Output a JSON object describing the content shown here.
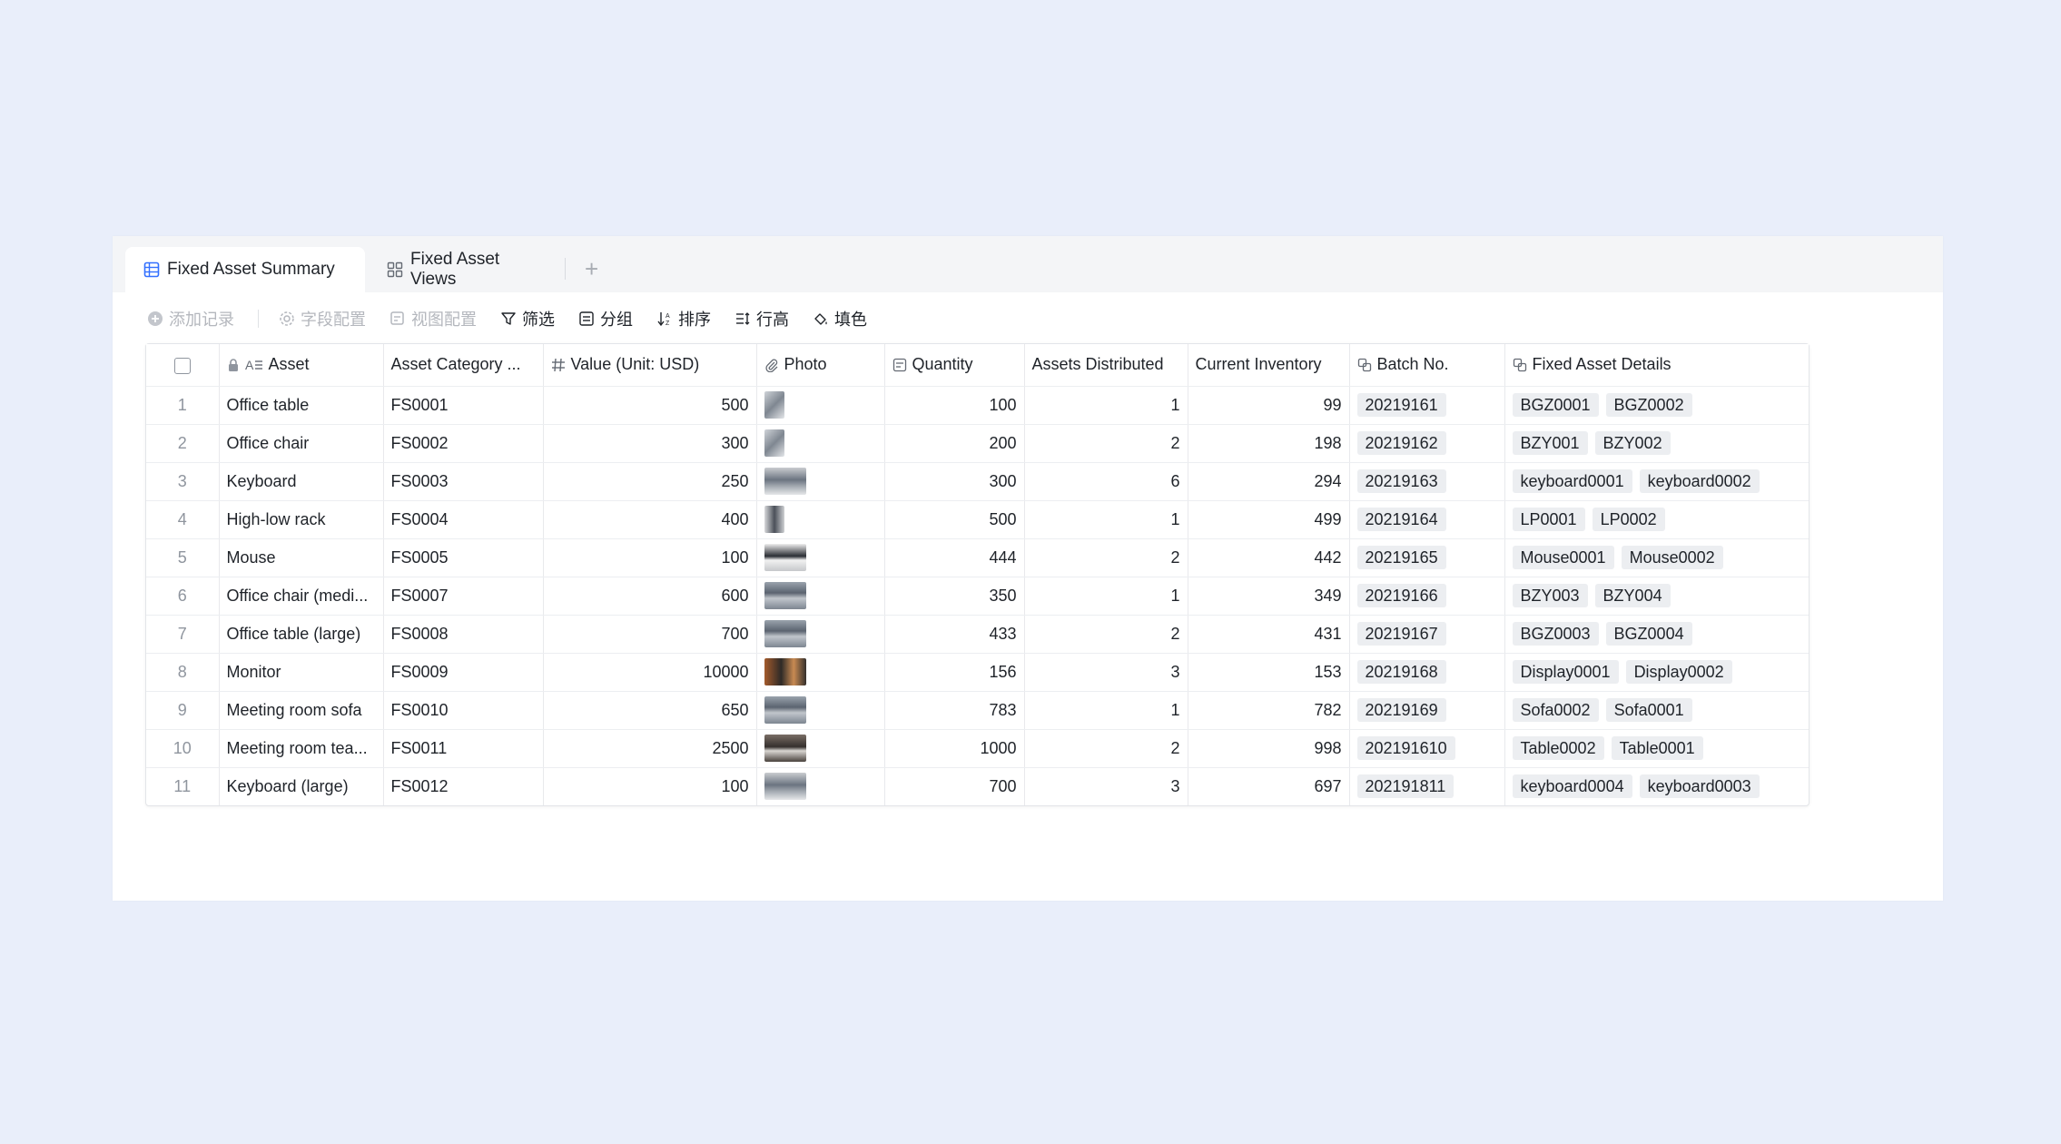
{
  "tabs": [
    {
      "label": "Fixed Asset Summary",
      "icon": "grid-table-icon",
      "active": true
    },
    {
      "label": "Fixed Asset Views",
      "icon": "four-squares-icon",
      "active": false
    }
  ],
  "add_tab_label": "+",
  "toolbar": {
    "add_record": "添加记录",
    "field_config": "字段配置",
    "view_config": "视图配置",
    "filter": "筛选",
    "group": "分组",
    "sort": "排序",
    "row_height": "行高",
    "fill_color": "填色"
  },
  "columns": {
    "asset": "Asset",
    "category": "Asset Category ...",
    "value": "Value (Unit: USD)",
    "photo": "Photo",
    "quantity": "Quantity",
    "distributed": "Assets Distributed",
    "inventory": "Current Inventory",
    "batch": "Batch No.",
    "details": "Fixed Asset Details"
  },
  "rows": [
    {
      "n": "1",
      "asset": "Office table",
      "cat": "FS0001",
      "value": "500",
      "photo": "office-table-photo",
      "qty": "100",
      "dist": "1",
      "inv": "99",
      "batch": "20219161",
      "details": [
        "BGZ0001",
        "BGZ0002"
      ]
    },
    {
      "n": "2",
      "asset": "Office chair",
      "cat": "FS0002",
      "value": "300",
      "photo": "office-chair-photo",
      "qty": "200",
      "dist": "2",
      "inv": "198",
      "batch": "20219162",
      "details": [
        "BZY001",
        "BZY002"
      ]
    },
    {
      "n": "3",
      "asset": "Keyboard",
      "cat": "FS0003",
      "value": "250",
      "photo": "keyboard-photo",
      "qty": "300",
      "dist": "6",
      "inv": "294",
      "batch": "20219163",
      "details": [
        "keyboard0001",
        "keyboard0002"
      ]
    },
    {
      "n": "4",
      "asset": "High-low rack",
      "cat": "FS0004",
      "value": "400",
      "photo": "rack-photo",
      "qty": "500",
      "dist": "1",
      "inv": "499",
      "batch": "20219164",
      "details": [
        "LP0001",
        "LP0002"
      ]
    },
    {
      "n": "5",
      "asset": "Mouse",
      "cat": "FS0005",
      "value": "100",
      "photo": "mouse-photo",
      "qty": "444",
      "dist": "2",
      "inv": "442",
      "batch": "20219165",
      "details": [
        "Mouse0001",
        "Mouse0002"
      ]
    },
    {
      "n": "6",
      "asset": "Office chair (medi...",
      "cat": "FS0007",
      "value": "600",
      "photo": "office-room-photo",
      "qty": "350",
      "dist": "1",
      "inv": "349",
      "batch": "20219166",
      "details": [
        "BZY003",
        "BZY004"
      ]
    },
    {
      "n": "7",
      "asset": "Office table (large)",
      "cat": "FS0008",
      "value": "700",
      "photo": "office-room-photo",
      "qty": "433",
      "dist": "2",
      "inv": "431",
      "batch": "20219167",
      "details": [
        "BGZ0003",
        "BGZ0004"
      ]
    },
    {
      "n": "8",
      "asset": "Monitor",
      "cat": "FS0009",
      "value": "10000",
      "photo": "monitor-photo",
      "qty": "156",
      "dist": "3",
      "inv": "153",
      "batch": "20219168",
      "details": [
        "Display0001",
        "Display0002"
      ]
    },
    {
      "n": "9",
      "asset": "Meeting room sofa",
      "cat": "FS0010",
      "value": "650",
      "photo": "office-room-photo",
      "qty": "783",
      "dist": "1",
      "inv": "782",
      "batch": "20219169",
      "details": [
        "Sofa0002",
        "Sofa0001"
      ]
    },
    {
      "n": "10",
      "asset": "Meeting room tea...",
      "cat": "FS0011",
      "value": "2500",
      "photo": "meeting-table-photo",
      "qty": "1000",
      "dist": "2",
      "inv": "998",
      "batch": "202191610",
      "details": [
        "Table0002",
        "Table0001"
      ]
    },
    {
      "n": "11",
      "asset": "Keyboard (large)",
      "cat": "FS0012",
      "value": "100",
      "photo": "keyboard-photo",
      "qty": "700",
      "dist": "3",
      "inv": "697",
      "batch": "202191811",
      "details": [
        "keyboard0004",
        "keyboard0003"
      ]
    }
  ]
}
